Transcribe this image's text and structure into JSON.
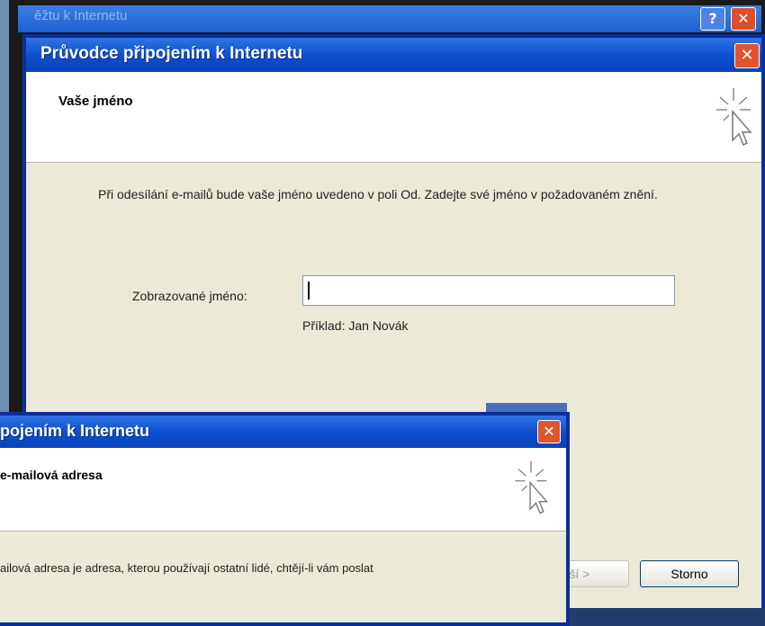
{
  "back_window": {
    "title": "ěžtu k Internetu",
    "help_label": "?",
    "close_label": "✕"
  },
  "main_window": {
    "title": "Průvodce připojením k Internetu",
    "close_label": "✕",
    "header_title": "Vaše jméno",
    "description": "Při odesílání e-mailů bude vaše jméno uvedeno v poli Od. Zadejte své jméno v požadovaném znění.",
    "display_name_label": "Zobrazované jméno:",
    "display_name_value": "",
    "example": "Příklad: Jan Novák",
    "next_label": "ší >",
    "cancel_label": "Storno"
  },
  "front_window": {
    "title": "pojením k Internetu",
    "close_label": "✕",
    "header_title": "e-mailová adresa",
    "description": "ailová adresa je adresa, kterou používají ostatní lidé, chtějí-li vám poslat"
  }
}
